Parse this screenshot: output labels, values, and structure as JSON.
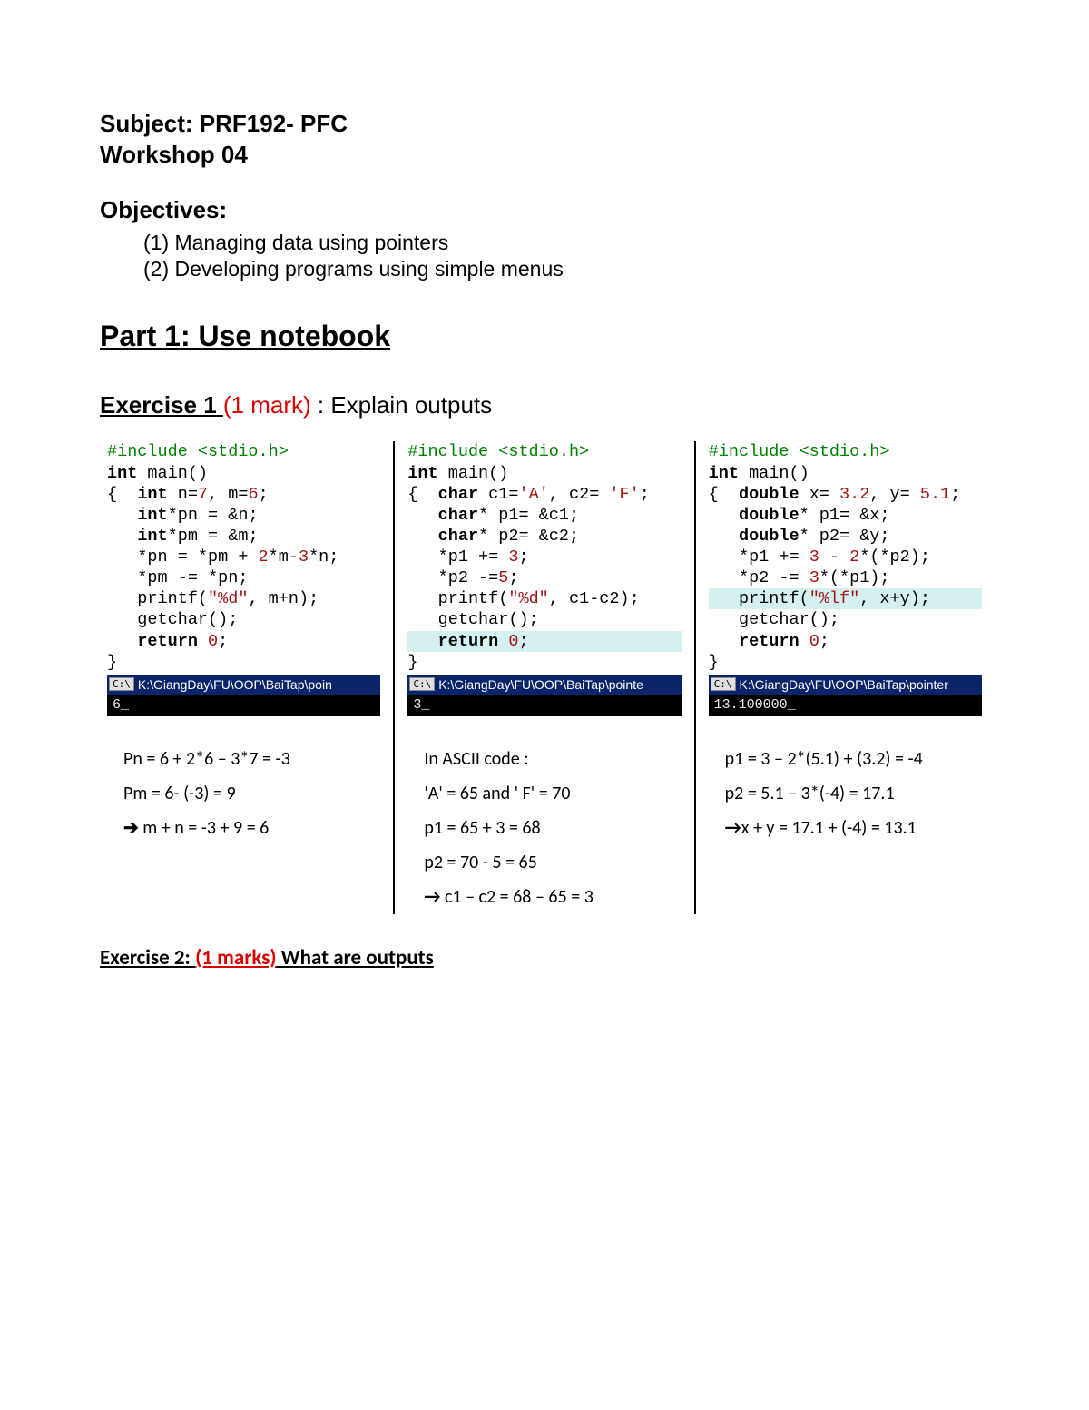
{
  "header": {
    "subject_line1": "Subject: PRF192- PFC",
    "subject_line2": "Workshop 04"
  },
  "objectives": {
    "title": "Objectives:",
    "items": [
      "(1) Managing data using pointers",
      "(2) Developing programs using simple menus"
    ]
  },
  "part1": {
    "title": "Part 1: Use notebook"
  },
  "exercise1": {
    "label": "Exercise 1 ",
    "mark": "(1 mark)",
    "desc": " : Explain outputs"
  },
  "col1": {
    "include": "#include <stdio.h>",
    "l2a": "int",
    "l2b": " main()",
    "l3a": "{  ",
    "l3b": "int",
    "l3c": " n=",
    "l3d": "7",
    "l3e": ", m=",
    "l3f": "6",
    "l3g": ";",
    "l4a": "   ",
    "l4b": "int",
    "l4c": "*pn = &n;",
    "l5a": "   ",
    "l5b": "int",
    "l5c": "*pm = &m;",
    "l6": "   *pn = *pm + ",
    "l6b": "2",
    "l6c": "*m-",
    "l6d": "3",
    "l6e": "*n;",
    "l7": "   *pm -= *pn;",
    "l8": "   printf(",
    "l8b": "\"%d\"",
    "l8c": ", m+n);",
    "l9": "   getchar();",
    "l10a": "   ",
    "l10b": "return",
    "l10c": " ",
    "l10d": "0",
    "l10e": ";",
    "l11": "}",
    "console_title": "K:\\GiangDay\\FU\\OOP\\BaiTap\\poin",
    "console_out": "6_",
    "calc": {
      "r1": "Pn = 6 + 2*6 – 3*7 = -3",
      "r2": "Pm = 6- (-3)  = 9",
      "r3arrow": "➔",
      "r3": "  m + n = -3 + 9 = 6"
    }
  },
  "col2": {
    "include": "#include <stdio.h>",
    "l2a": "int",
    "l2b": " main()",
    "l3a": "{  ",
    "l3b": "char",
    "l3c": " c1=",
    "l3d": "'A'",
    "l3e": ", c2= ",
    "l3f": "'F'",
    "l3g": ";",
    "l4a": "   ",
    "l4b": "char",
    "l4c": "* p1= &c1;",
    "l5a": "   ",
    "l5b": "char",
    "l5c": "* p2= &c2;",
    "l6": "   *p1 += ",
    "l6b": "3",
    "l6c": ";",
    "l7": "   *p2 -=",
    "l7b": "5",
    "l7c": ";",
    "l8": "   printf(",
    "l8b": "\"%d\"",
    "l8c": ", c1-c2);",
    "l9": "   getchar();",
    "l10a": "   ",
    "l10b": "return",
    "l10c": " ",
    "l10d": "0",
    "l10e": ";",
    "l11": "}",
    "console_title": "K:\\GiangDay\\FU\\OOP\\BaiTap\\pointe",
    "console_out": "3_",
    "calc": {
      "r1": "In ASCII code :",
      "r2": "'A' = 65 and ' F' = 70",
      "r3": "  p1 = 65 + 3 = 68",
      "r4": "  p2 = 70 - 5 = 65",
      "r5arrow": "→",
      "r5": " c1 – c2 = 68 – 65 = 3"
    }
  },
  "col3": {
    "include": "#include <stdio.h>",
    "l2a": "int",
    "l2b": " main()",
    "l3a": "{  ",
    "l3b": "double",
    "l3c": " x= ",
    "l3d": "3.2",
    "l3e": ", y= ",
    "l3f": "5.1",
    "l3g": ";",
    "l4a": "   ",
    "l4b": "double",
    "l4c": "* p1= &x;",
    "l5a": "   ",
    "l5b": "double",
    "l5c": "* p2= &y;",
    "l6": "   *p1 += ",
    "l6b": "3",
    "l6c": " - ",
    "l6d": "2",
    "l6e": "*(*p2);",
    "l7": "   *p2 -= ",
    "l7b": "3",
    "l7c": "*(*p1);",
    "l8": "   printf(",
    "l8b": "\"%lf\"",
    "l8c": ", x+y);",
    "l9": "   getchar();",
    "l10a": "   ",
    "l10b": "return",
    "l10c": " ",
    "l10d": "0",
    "l10e": ";",
    "l11": "}",
    "console_title": "K:\\GiangDay\\FU\\OOP\\BaiTap\\pointer",
    "console_out": "13.100000_",
    "calc": {
      "r1": "p1 = 3 – 2*(5.1) + (3.2) = -4",
      "r2": "p2 = 5.1 – 3*(-4)  = 17.1",
      "r3arrow": "→",
      "r3": "x + y = 17.1 + (-4) = 13.1"
    }
  },
  "exercise2": {
    "label": "Exercise 2: ",
    "mark": "(1 marks)",
    "rest": " What are outputs"
  }
}
